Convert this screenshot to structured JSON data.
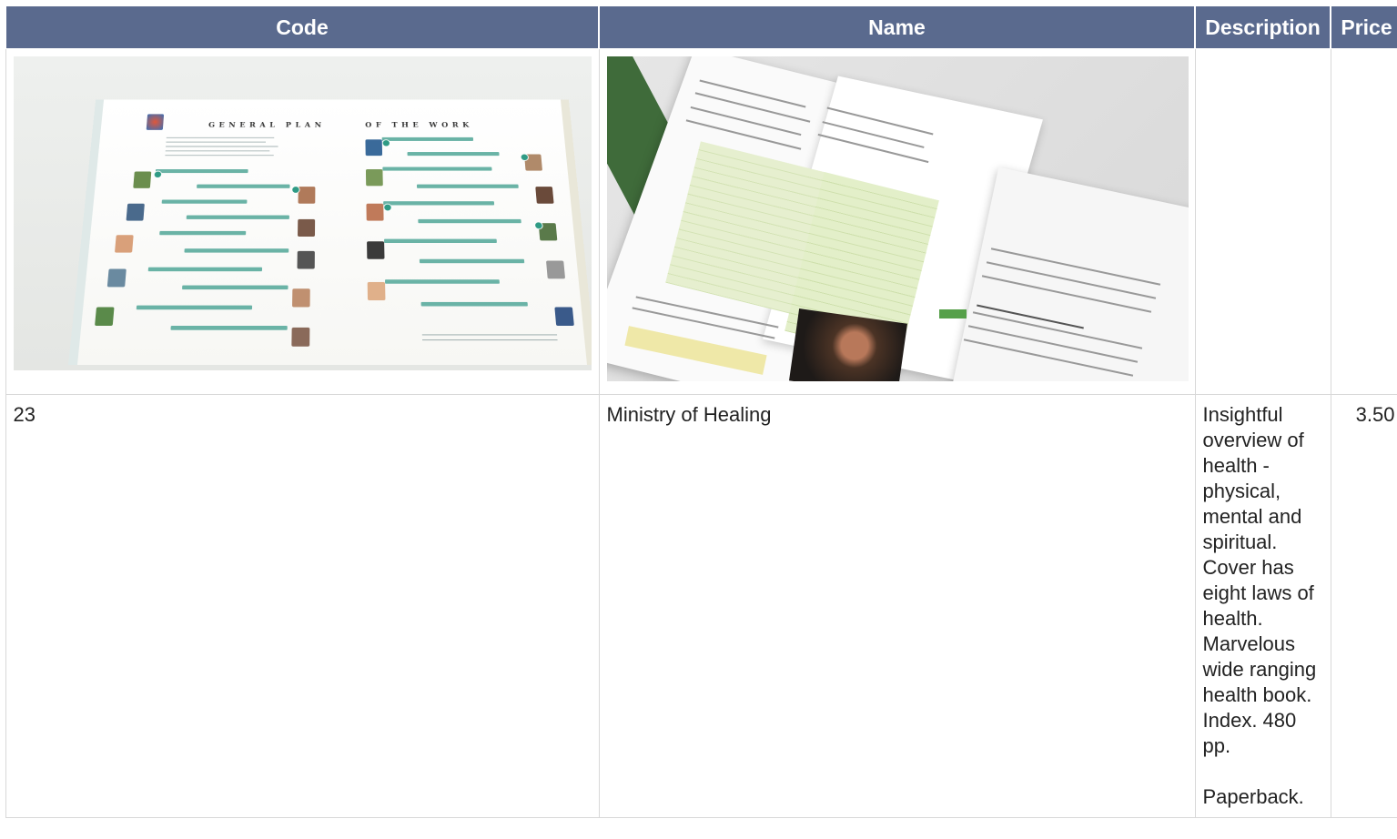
{
  "table": {
    "headers": {
      "code": "Code",
      "name": "Name",
      "description": "Description",
      "price": "Price"
    },
    "row": {
      "code": "23",
      "name": "Ministry of Healing",
      "description": "Insightful overview of health - physical, mental and spiritual. Cover has eight laws of health. Marvelous wide ranging health book. Index. 480 pp.\n\nPaperback.",
      "price": "3.50"
    }
  }
}
